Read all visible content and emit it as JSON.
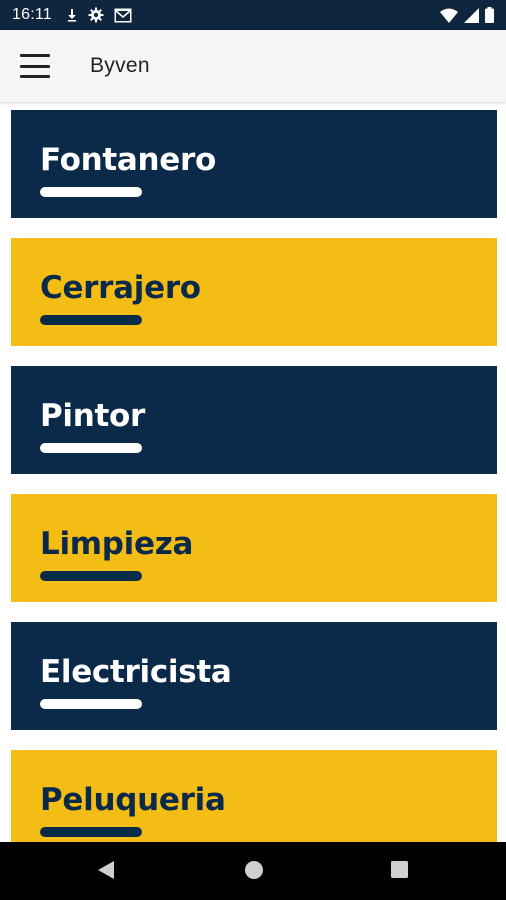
{
  "status_bar": {
    "time": "16:11",
    "left_icons": [
      "download-icon",
      "settings-icon",
      "mail-icon"
    ],
    "right_icons": [
      "wifi-icon",
      "signal-icon",
      "battery-icon"
    ]
  },
  "app_bar": {
    "menu_icon": "hamburger-menu-icon",
    "title": "Byven"
  },
  "colors": {
    "navy": "#0b2a4a",
    "yellow": "#f4bd16",
    "status_bar": "#10263f",
    "app_bar": "#f5f5f5"
  },
  "categories": [
    {
      "label": "Fontanero",
      "style": "dark"
    },
    {
      "label": "Cerrajero",
      "style": "yellow"
    },
    {
      "label": "Pintor",
      "style": "dark"
    },
    {
      "label": "Limpieza",
      "style": "yellow"
    },
    {
      "label": "Electricista",
      "style": "dark"
    },
    {
      "label": "Peluqueria",
      "style": "yellow"
    }
  ],
  "nav_bar": {
    "buttons": [
      "back-icon",
      "home-icon",
      "recents-icon"
    ]
  }
}
